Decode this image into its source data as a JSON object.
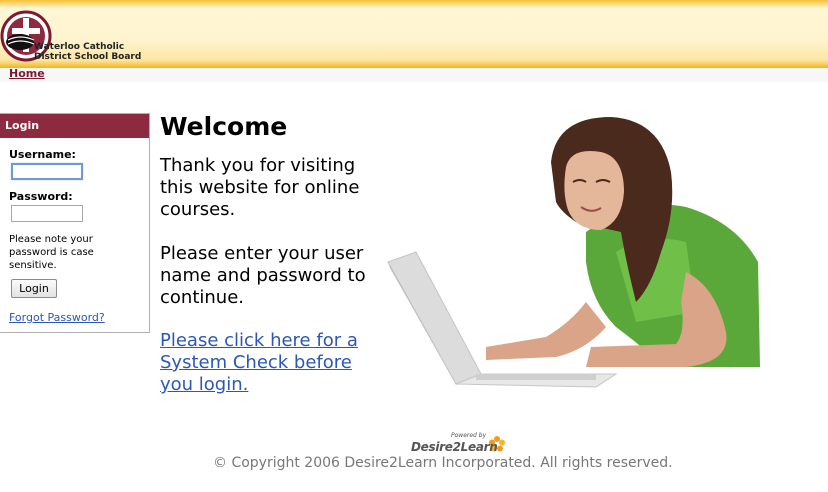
{
  "header": {
    "org_name_line1": "Waterloo Catholic",
    "org_name_line2": "District School Board"
  },
  "nav": {
    "home_label": "Home"
  },
  "login": {
    "title": "Login",
    "username_label": "Username:",
    "username_value": "",
    "password_label": "Password:",
    "password_value": "",
    "case_note": "Please note your password is case sensitive.",
    "button_label": "Login",
    "forgot_label": "Forgot Password?"
  },
  "main": {
    "title": "Welcome",
    "intro": "Thank you for visiting this website for online courses.",
    "instruction": "Please enter your user name and password to continue.",
    "system_check_link": "Please click here for a System Check before you login."
  },
  "footer": {
    "powered_by": "Powered by",
    "brand": "Desire2Learn",
    "copyright": "© Copyright 2006 Desire2Learn Incorporated. All rights reserved."
  },
  "colors": {
    "header_gold": "#f6c23a",
    "login_header": "#8e2a3f",
    "link_blue": "#2a57b8",
    "home_link": "#7b1a2e"
  }
}
